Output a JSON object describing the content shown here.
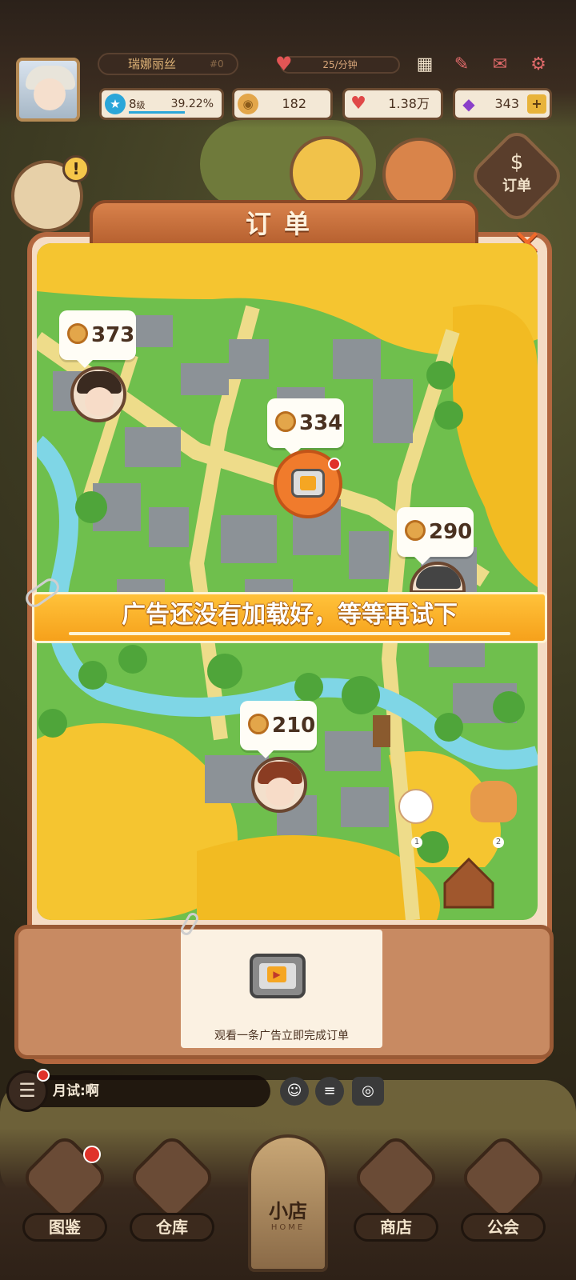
{
  "hud": {
    "player_name": "瑞娜丽丝",
    "player_id": "#0",
    "energy_rate": "25/分钟",
    "level": "8",
    "level_unit": "级",
    "level_progress": "39.22%",
    "coins": "182",
    "hearts": "1.38万",
    "gems": "343",
    "gem_add": "+"
  },
  "side": {
    "order_label": "订单",
    "order_symbol": "$",
    "alert": "!"
  },
  "panel": {
    "title": "订单",
    "close": "✕",
    "orders": [
      {
        "reward": "373"
      },
      {
        "reward": "334"
      },
      {
        "reward": "290"
      },
      {
        "reward": "210"
      }
    ],
    "pet_labels": [
      "1",
      "2"
    ]
  },
  "toast": {
    "message": "广告还没有加载好，等等再试下"
  },
  "ad_card": {
    "caption": "观看一条广告立即完成订单"
  },
  "chat": {
    "message": "月试:啊"
  },
  "nav": {
    "items": [
      {
        "label": "图鉴"
      },
      {
        "label": "仓库"
      },
      {
        "label": "商店"
      },
      {
        "label": "公会"
      }
    ],
    "home_label": "小店",
    "home_sub": "HOME"
  },
  "colors": {
    "accent": "#f07b2c",
    "panel_border": "#b3673f",
    "toast": "#f6a11b"
  }
}
